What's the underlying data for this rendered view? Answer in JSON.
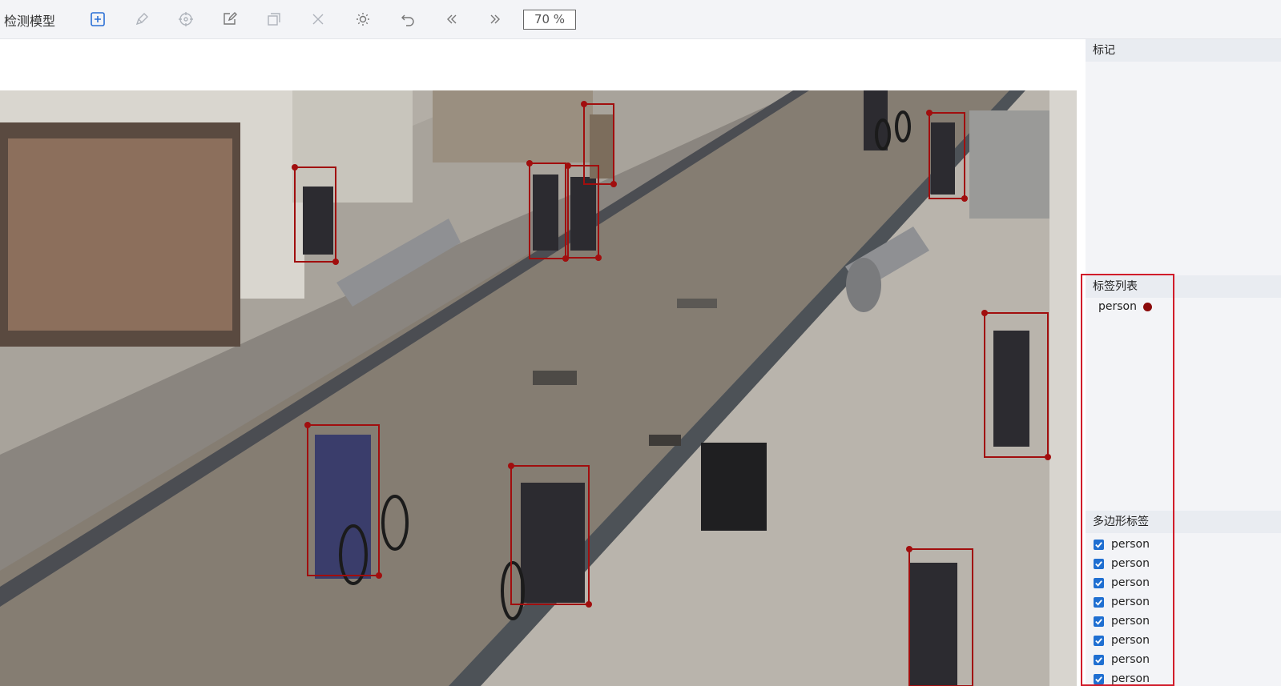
{
  "app": {
    "title": "检测模型"
  },
  "toolbar": {
    "tools": [
      {
        "name": "add-box",
        "icon": "plus-square-icon"
      },
      {
        "name": "pen",
        "icon": "pen-icon"
      },
      {
        "name": "crosshair",
        "icon": "crosshair-icon"
      },
      {
        "name": "edit",
        "icon": "edit-icon"
      },
      {
        "name": "copy",
        "icon": "copy-icon"
      },
      {
        "name": "close",
        "icon": "close-icon"
      },
      {
        "name": "brightness",
        "icon": "sun-icon"
      },
      {
        "name": "undo",
        "icon": "undo-icon"
      },
      {
        "name": "prev",
        "icon": "double-left-icon"
      },
      {
        "name": "next",
        "icon": "double-right-icon"
      }
    ],
    "zoom": "70 %"
  },
  "panel": {
    "marks_title": "标记",
    "labels_title": "标签列表",
    "legend_label": "person",
    "legend_color": "#8b0b0b",
    "polygons_title": "多边形标签",
    "polygons": [
      "person",
      "person",
      "person",
      "person",
      "person",
      "person",
      "person",
      "person"
    ]
  },
  "annotations": {
    "box_color": "#a10e0e",
    "label": "person",
    "count": 10
  }
}
